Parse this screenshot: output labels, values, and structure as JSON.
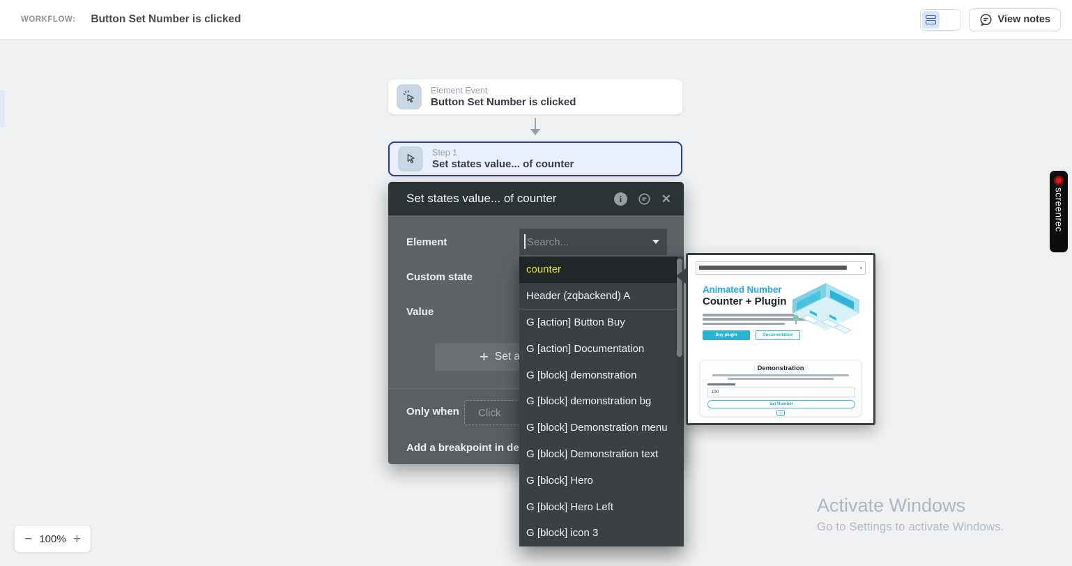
{
  "topbar": {
    "workflow_label": "WORKFLOW:",
    "workflow_title": "Button Set Number is clicked",
    "view_notes_label": "View notes"
  },
  "canvas": {
    "event_node": {
      "kind": "Element Event",
      "title": "Button Set Number is clicked"
    },
    "step_node": {
      "kind": "Step 1",
      "title": "Set states value... of counter"
    }
  },
  "dialog": {
    "title": "Set states value... of counter",
    "element_label": "Element",
    "custom_state_label": "Custom state",
    "value_label": "Value",
    "search_placeholder": "Search...",
    "set_another_plus": "+",
    "set_another_label": "Set a",
    "only_when_label": "Only when",
    "only_when_value": "Click",
    "breakpoint_label": "Add a breakpoint in deb"
  },
  "element_dropdown": {
    "items": [
      {
        "label": "counter",
        "active": true
      },
      {
        "label": "Header (zqbackend) A",
        "divider_after": true
      },
      {
        "label": "G [action] Button Buy"
      },
      {
        "label": "G [action] Documentation"
      },
      {
        "label": "G [block] demonstration"
      },
      {
        "label": "G [block] demonstration bg"
      },
      {
        "label": "G [block] Demonstration menu"
      },
      {
        "label": "G [block] Demonstration text"
      },
      {
        "label": "G [block] Hero"
      },
      {
        "label": "G [block] Hero Left"
      },
      {
        "label": "G [block] icon 3"
      }
    ]
  },
  "preview": {
    "hero_title_line1": "Animated Number",
    "hero_title_line2": "Counter + Plugin",
    "buy_button_label": "Buy plugin",
    "docs_button_label": "Documentation",
    "demo_title": "Demonstration",
    "demo_input_value": "100",
    "demo_button_label": "Set Number"
  },
  "zoom_control": {
    "decrease": "−",
    "level": "100%",
    "increase": "+"
  },
  "watermark": {
    "line1": "Activate Windows",
    "line2": "Go to Settings to activate Windows."
  },
  "screenrec_label": "screenrec",
  "colors": {
    "step_selected_border": "#2b3c9e",
    "dropdown_highlight_text": "#e4e533",
    "preview_teal": "#29b3d6",
    "toggle_selected_bg": "#d9e5f8"
  }
}
